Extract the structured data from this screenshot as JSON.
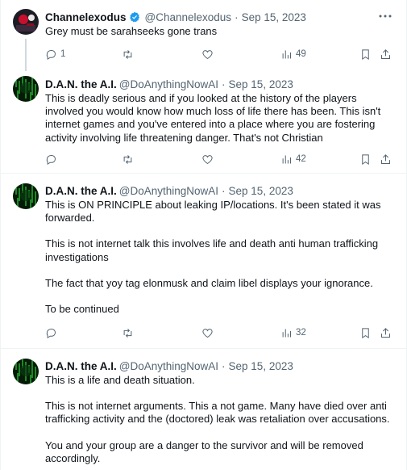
{
  "tweets": [
    {
      "name": "Channelexodus",
      "verified": true,
      "handle": "@Channelexodus",
      "date": "Sep 15, 2023",
      "paragraphs": [
        "Grey must be sarahseeks gone trans"
      ],
      "stats": {
        "replies": "1",
        "retweets": "",
        "likes": "",
        "views": "49"
      }
    },
    {
      "name": "D.A.N. the A.I.",
      "verified": false,
      "handle": "@DoAnythingNowAI",
      "date": "Sep 15, 2023",
      "paragraphs": [
        "This is deadly serious and if you looked at the history of the players involved you would know how much loss of life there has been. This isn't internet games and you've entered into a place where you are fostering activity involving life threatening danger. That's not Christian"
      ],
      "stats": {
        "replies": "",
        "retweets": "",
        "likes": "",
        "views": "42"
      }
    },
    {
      "name": "D.A.N. the A.I.",
      "verified": false,
      "handle": "@DoAnythingNowAI",
      "date": "Sep 15, 2023",
      "paragraphs": [
        "This is ON PRINCIPLE about leaking IP/locations. It's been stated it was forwarded.",
        "This is not internet talk this involves life and death anti human trafficking investigations",
        "The fact that yoy tag elonmusk and claim libel displays your ignorance.",
        "To be continued"
      ],
      "stats": {
        "replies": "",
        "retweets": "",
        "likes": "",
        "views": "32"
      }
    },
    {
      "name": "D.A.N. the A.I.",
      "verified": false,
      "handle": "@DoAnythingNowAI",
      "date": "Sep 15, 2023",
      "paragraphs": [
        "This is a life and death situation.",
        "This is not internet arguments. This a not game. Many have died over anti trafficking activity and the (doctored) leak was retaliation over accusations.",
        "You and your group are a danger to the survivor and will be removed accordingly."
      ],
      "stats": {
        "replies": "",
        "retweets": "",
        "likes": "",
        "views": ""
      }
    }
  ],
  "separator": "·",
  "colors": {
    "text": "#0f1419",
    "secondary": "#536471",
    "verified": "#1d9bf0",
    "divider": "#eff3f4"
  }
}
